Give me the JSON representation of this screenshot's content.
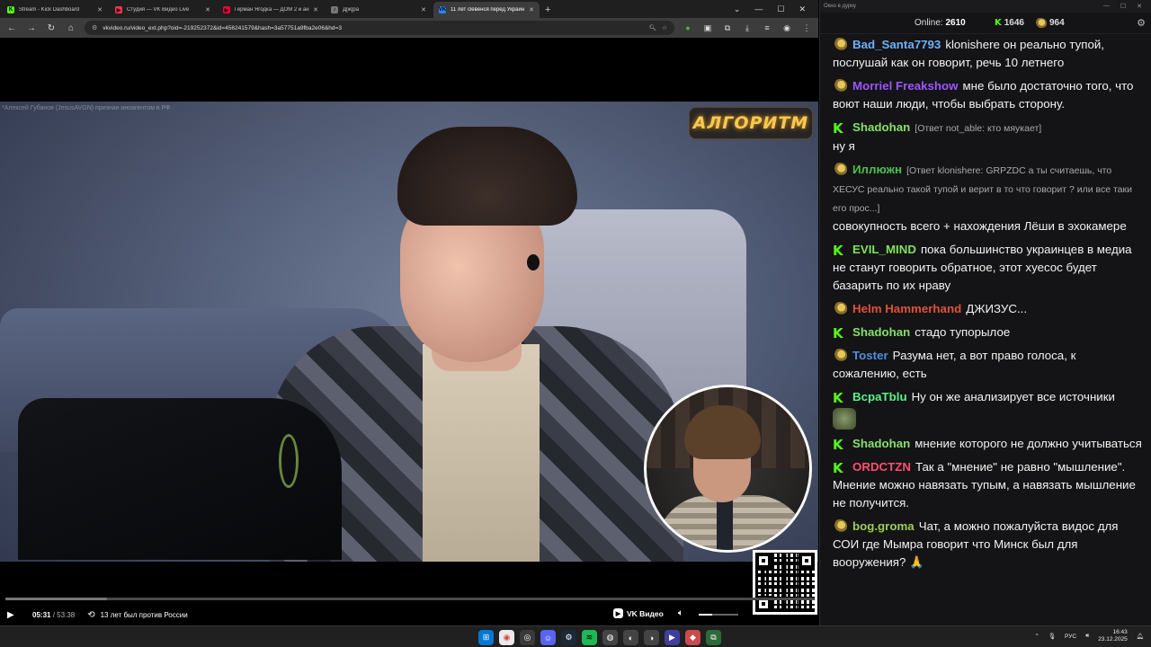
{
  "browser": {
    "tabs": [
      {
        "title": "Stream - Kick Dashboard",
        "favicon_color": "#53fc18",
        "favicon_glyph": "K",
        "active": false
      },
      {
        "title": "Студия — VK Видео Live",
        "favicon_color": "#ff3347",
        "favicon_glyph": "▶",
        "active": false
      },
      {
        "title": "Герман Ягодка — ДОМ 2 и ан",
        "favicon_color": "#ff0033",
        "favicon_glyph": "▶",
        "active": false
      },
      {
        "title": "Д[ж]ра",
        "favicon_color": "#777777",
        "favicon_glyph": "♪",
        "active": false
      },
      {
        "title": "11 лет сleвeнся перед Украин",
        "favicon_color": "#2787f5",
        "favicon_glyph": "VK",
        "active": true
      }
    ],
    "new_tab": "+",
    "url": "vkvideo.ru/video_ext.php?oid=-219252372&id=456241579&hash=3a57751a9fba2e06&hd=3"
  },
  "video": {
    "caption": "*Алексей Губанов (JesusAVGN) признан иноагентом в РФ",
    "brand": "АЛГОРИТМ",
    "current_time": "05:31",
    "duration": "53:38",
    "progress": 0.103,
    "buffered": 0.125,
    "chapter": "13 лет был против России",
    "player_logo": "VK Видео",
    "volume": 0.35
  },
  "chat": {
    "window_title": "Окно в дурку",
    "online_label": "Online:",
    "online_count": "2610",
    "kick_count": "1646",
    "twitch_count": "964",
    "messages": [
      {
        "platform": "rat",
        "nick": "Bad_Santa7793",
        "nick_color": "#6fb1ff",
        "reply": "",
        "text": "klonishere он реально тупой, послушай как он говорит, речь 10 летнего",
        "mention": "klonishere"
      },
      {
        "platform": "rat",
        "nick": "Morriel Freakshow",
        "nick_color": "#9b57ff",
        "reply": "",
        "text": "мне было достаточно того, что воют наши люди, чтобы выбрать сторону."
      },
      {
        "platform": "kick",
        "nick": "Shadohan",
        "nick_color": "#87e06a",
        "reply": "[Ответ not_able: кто мяукает]",
        "text": "ну я"
      },
      {
        "platform": "rat",
        "nick": "Иллюжн",
        "nick_color": "#4fbf4f",
        "reply": "[Ответ klonishere: GRPZDC а ты считаешь, что ХЕСУС реально такой тупой и верит в то что говорит ? или все таки его прос...]",
        "text": "совокупность всего + нахождения Лёши в эхокамере"
      },
      {
        "platform": "kick",
        "nick": "EVIL_MIND",
        "nick_color": "#7ee25a",
        "reply": "",
        "text": "пока большинство украинцев в медиа не станут говорить обратное, этот хуесос будет базарить по их нраву"
      },
      {
        "platform": "rat",
        "nick": "Helm Hammerhand",
        "nick_color": "#e0523a",
        "reply": "",
        "text": "ДЖИЗУС..."
      },
      {
        "platform": "kick",
        "nick": "Shadohan",
        "nick_color": "#87e06a",
        "reply": "",
        "text": "стадо тупорылое"
      },
      {
        "platform": "rat",
        "nick": "Toster",
        "nick_color": "#4f8fd8",
        "reply": "",
        "text": "Разума нет, а вот право голоса, к сожалению, есть"
      },
      {
        "platform": "kick",
        "nick": "BcpaTblu",
        "nick_color": "#5ef08a",
        "reply": "",
        "text": "Ну он же анализирует все источники",
        "emote": true
      },
      {
        "platform": "kick",
        "nick": "Shadohan",
        "nick_color": "#87e06a",
        "reply": "",
        "text": "мнение которого не должно учитываться"
      },
      {
        "platform": "kick",
        "nick": "ORDCTZN",
        "nick_color": "#ff4f6d",
        "reply": "",
        "text": "Так а \"мнение\" не равно \"мышление\". Мнение можно навязать тупым, а навязать мышление не получится."
      },
      {
        "platform": "rat",
        "nick": "bog.groma",
        "nick_color": "#9acd5a",
        "reply": "",
        "text": "Чат, а можно пожалуйста видос для СОИ где Мымра говорит что Минск был для вооружения? 🙏"
      }
    ]
  },
  "taskbar": {
    "lang": "РУС",
    "time": "16:43",
    "date": "23.12.2025"
  }
}
